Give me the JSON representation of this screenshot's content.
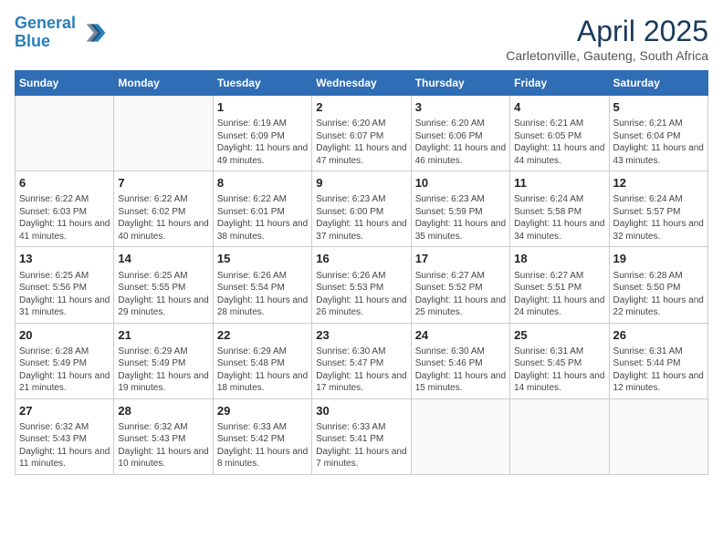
{
  "header": {
    "logo_line1": "General",
    "logo_line2": "Blue",
    "month_title": "April 2025",
    "subtitle": "Carletonville, Gauteng, South Africa"
  },
  "weekdays": [
    "Sunday",
    "Monday",
    "Tuesday",
    "Wednesday",
    "Thursday",
    "Friday",
    "Saturday"
  ],
  "weeks": [
    [
      {
        "day": "",
        "info": ""
      },
      {
        "day": "",
        "info": ""
      },
      {
        "day": "1",
        "info": "Sunrise: 6:19 AM\nSunset: 6:09 PM\nDaylight: 11 hours and 49 minutes."
      },
      {
        "day": "2",
        "info": "Sunrise: 6:20 AM\nSunset: 6:07 PM\nDaylight: 11 hours and 47 minutes."
      },
      {
        "day": "3",
        "info": "Sunrise: 6:20 AM\nSunset: 6:06 PM\nDaylight: 11 hours and 46 minutes."
      },
      {
        "day": "4",
        "info": "Sunrise: 6:21 AM\nSunset: 6:05 PM\nDaylight: 11 hours and 44 minutes."
      },
      {
        "day": "5",
        "info": "Sunrise: 6:21 AM\nSunset: 6:04 PM\nDaylight: 11 hours and 43 minutes."
      }
    ],
    [
      {
        "day": "6",
        "info": "Sunrise: 6:22 AM\nSunset: 6:03 PM\nDaylight: 11 hours and 41 minutes."
      },
      {
        "day": "7",
        "info": "Sunrise: 6:22 AM\nSunset: 6:02 PM\nDaylight: 11 hours and 40 minutes."
      },
      {
        "day": "8",
        "info": "Sunrise: 6:22 AM\nSunset: 6:01 PM\nDaylight: 11 hours and 38 minutes."
      },
      {
        "day": "9",
        "info": "Sunrise: 6:23 AM\nSunset: 6:00 PM\nDaylight: 11 hours and 37 minutes."
      },
      {
        "day": "10",
        "info": "Sunrise: 6:23 AM\nSunset: 5:59 PM\nDaylight: 11 hours and 35 minutes."
      },
      {
        "day": "11",
        "info": "Sunrise: 6:24 AM\nSunset: 5:58 PM\nDaylight: 11 hours and 34 minutes."
      },
      {
        "day": "12",
        "info": "Sunrise: 6:24 AM\nSunset: 5:57 PM\nDaylight: 11 hours and 32 minutes."
      }
    ],
    [
      {
        "day": "13",
        "info": "Sunrise: 6:25 AM\nSunset: 5:56 PM\nDaylight: 11 hours and 31 minutes."
      },
      {
        "day": "14",
        "info": "Sunrise: 6:25 AM\nSunset: 5:55 PM\nDaylight: 11 hours and 29 minutes."
      },
      {
        "day": "15",
        "info": "Sunrise: 6:26 AM\nSunset: 5:54 PM\nDaylight: 11 hours and 28 minutes."
      },
      {
        "day": "16",
        "info": "Sunrise: 6:26 AM\nSunset: 5:53 PM\nDaylight: 11 hours and 26 minutes."
      },
      {
        "day": "17",
        "info": "Sunrise: 6:27 AM\nSunset: 5:52 PM\nDaylight: 11 hours and 25 minutes."
      },
      {
        "day": "18",
        "info": "Sunrise: 6:27 AM\nSunset: 5:51 PM\nDaylight: 11 hours and 24 minutes."
      },
      {
        "day": "19",
        "info": "Sunrise: 6:28 AM\nSunset: 5:50 PM\nDaylight: 11 hours and 22 minutes."
      }
    ],
    [
      {
        "day": "20",
        "info": "Sunrise: 6:28 AM\nSunset: 5:49 PM\nDaylight: 11 hours and 21 minutes."
      },
      {
        "day": "21",
        "info": "Sunrise: 6:29 AM\nSunset: 5:49 PM\nDaylight: 11 hours and 19 minutes."
      },
      {
        "day": "22",
        "info": "Sunrise: 6:29 AM\nSunset: 5:48 PM\nDaylight: 11 hours and 18 minutes."
      },
      {
        "day": "23",
        "info": "Sunrise: 6:30 AM\nSunset: 5:47 PM\nDaylight: 11 hours and 17 minutes."
      },
      {
        "day": "24",
        "info": "Sunrise: 6:30 AM\nSunset: 5:46 PM\nDaylight: 11 hours and 15 minutes."
      },
      {
        "day": "25",
        "info": "Sunrise: 6:31 AM\nSunset: 5:45 PM\nDaylight: 11 hours and 14 minutes."
      },
      {
        "day": "26",
        "info": "Sunrise: 6:31 AM\nSunset: 5:44 PM\nDaylight: 11 hours and 12 minutes."
      }
    ],
    [
      {
        "day": "27",
        "info": "Sunrise: 6:32 AM\nSunset: 5:43 PM\nDaylight: 11 hours and 11 minutes."
      },
      {
        "day": "28",
        "info": "Sunrise: 6:32 AM\nSunset: 5:43 PM\nDaylight: 11 hours and 10 minutes."
      },
      {
        "day": "29",
        "info": "Sunrise: 6:33 AM\nSunset: 5:42 PM\nDaylight: 11 hours and 8 minutes."
      },
      {
        "day": "30",
        "info": "Sunrise: 6:33 AM\nSunset: 5:41 PM\nDaylight: 11 hours and 7 minutes."
      },
      {
        "day": "",
        "info": ""
      },
      {
        "day": "",
        "info": ""
      },
      {
        "day": "",
        "info": ""
      }
    ]
  ]
}
